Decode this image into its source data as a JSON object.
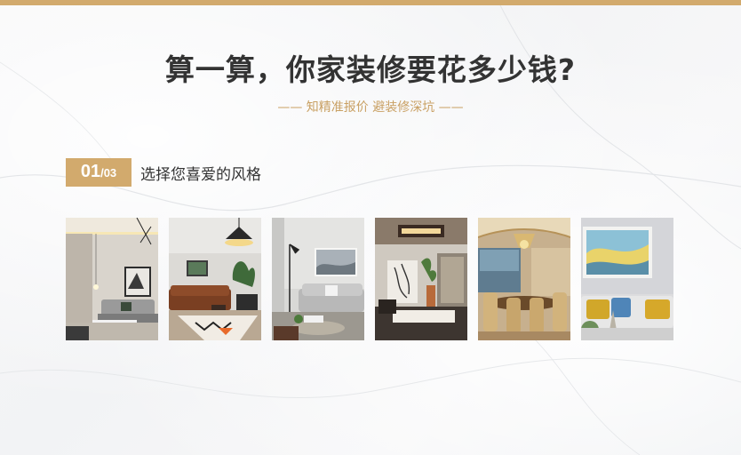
{
  "header": {
    "title": "算一算，你家装修要花多少钱?",
    "subtitle": "—— 知精准报价  避装修深坑 ——"
  },
  "step": {
    "current": "01",
    "total": "/03",
    "label": "选择您喜爱的风格"
  },
  "styles": [
    {
      "id": "style-1",
      "theme": "modern-light-living-room"
    },
    {
      "id": "style-2",
      "theme": "leather-sofa-pendant-lamp"
    },
    {
      "id": "style-3",
      "theme": "grey-sofa-floor-lamp"
    },
    {
      "id": "style-4",
      "theme": "new-chinese-dark-wood"
    },
    {
      "id": "style-5",
      "theme": "european-classic-dining"
    },
    {
      "id": "style-6",
      "theme": "scandinavian-yellow-cushions"
    }
  ],
  "colors": {
    "accent": "#d2aa6d",
    "title": "#333333",
    "subtitle": "#c9a063"
  }
}
